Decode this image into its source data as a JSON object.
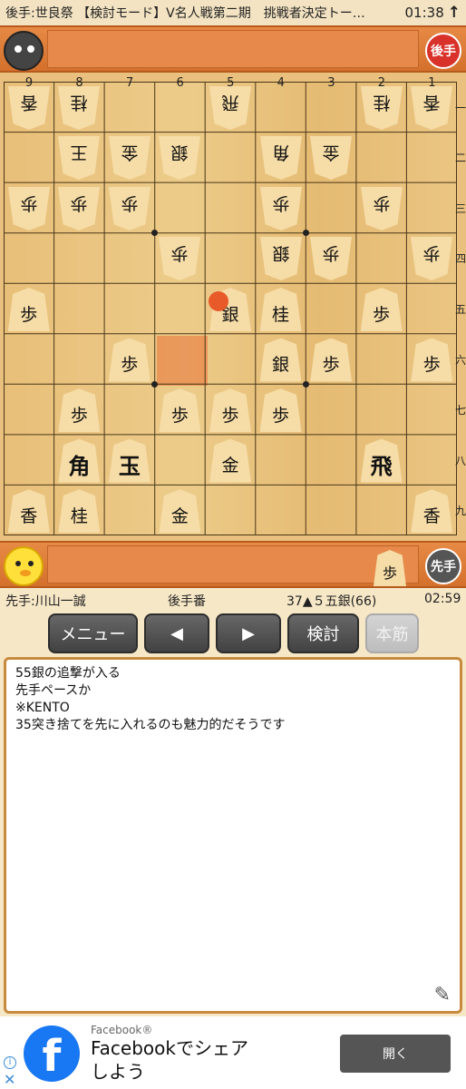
{
  "top_bar": {
    "title": "後手:世良祭 【検討モード】V名人戦第二期　挑戦者決定トー…",
    "clock": "01:38",
    "arrow": "↑"
  },
  "gote": {
    "badge": "後手"
  },
  "sente": {
    "badge": "先手",
    "hand_piece": "歩"
  },
  "board": {
    "col_numbers": [
      "9",
      "8",
      "7",
      "6",
      "5",
      "4",
      "3",
      "2",
      "1"
    ],
    "row_numbers": [
      "一",
      "二",
      "三",
      "四",
      "五",
      "六",
      "七",
      "八",
      "九"
    ],
    "pieces": [
      {
        "file": 9,
        "rank": 1,
        "label": "香",
        "owner": "gote"
      },
      {
        "file": 8,
        "rank": 1,
        "label": "桂",
        "owner": "gote"
      },
      {
        "file": 5,
        "rank": 1,
        "label": "飛",
        "owner": "gote"
      },
      {
        "file": 2,
        "rank": 1,
        "label": "桂",
        "owner": "gote"
      },
      {
        "file": 1,
        "rank": 1,
        "label": "香",
        "owner": "gote"
      },
      {
        "file": 8,
        "rank": 2,
        "label": "王",
        "owner": "gote"
      },
      {
        "file": 7,
        "rank": 2,
        "label": "金",
        "owner": "gote"
      },
      {
        "file": 6,
        "rank": 2,
        "label": "銀",
        "owner": "gote"
      },
      {
        "file": 4,
        "rank": 2,
        "label": "角",
        "owner": "gote"
      },
      {
        "file": 3,
        "rank": 2,
        "label": "金",
        "owner": "gote"
      },
      {
        "file": 9,
        "rank": 3,
        "label": "歩",
        "owner": "gote"
      },
      {
        "file": 8,
        "rank": 3,
        "label": "歩",
        "owner": "gote"
      },
      {
        "file": 7,
        "rank": 3,
        "label": "歩",
        "owner": "gote"
      },
      {
        "file": 4,
        "rank": 3,
        "label": "歩",
        "owner": "gote"
      },
      {
        "file": 2,
        "rank": 3,
        "label": "歩",
        "owner": "gote"
      },
      {
        "file": 6,
        "rank": 4,
        "label": "歩",
        "owner": "gote"
      },
      {
        "file": 4,
        "rank": 4,
        "label": "銀",
        "owner": "gote"
      },
      {
        "file": 3,
        "rank": 4,
        "label": "歩",
        "owner": "gote"
      },
      {
        "file": 1,
        "rank": 4,
        "label": "歩",
        "owner": "gote"
      },
      {
        "file": 9,
        "rank": 5,
        "label": "歩",
        "owner": "sente"
      },
      {
        "file": 5,
        "rank": 5,
        "label": "銀",
        "owner": "sente"
      },
      {
        "file": 4,
        "rank": 5,
        "label": "桂",
        "owner": "sente"
      },
      {
        "file": 2,
        "rank": 5,
        "label": "歩",
        "owner": "sente"
      },
      {
        "file": 7,
        "rank": 6,
        "label": "歩",
        "owner": "sente"
      },
      {
        "file": 4,
        "rank": 6,
        "label": "銀",
        "owner": "sente"
      },
      {
        "file": 3,
        "rank": 6,
        "label": "歩",
        "owner": "sente"
      },
      {
        "file": 1,
        "rank": 6,
        "label": "歩",
        "owner": "sente"
      },
      {
        "file": 8,
        "rank": 7,
        "label": "歩",
        "owner": "sente"
      },
      {
        "file": 6,
        "rank": 7,
        "label": "歩",
        "owner": "sente"
      },
      {
        "file": 5,
        "rank": 7,
        "label": "歩",
        "owner": "sente"
      },
      {
        "file": 4,
        "rank": 7,
        "label": "歩",
        "owner": "sente"
      },
      {
        "file": 8,
        "rank": 8,
        "label": "角",
        "owner": "sente",
        "big": true
      },
      {
        "file": 7,
        "rank": 8,
        "label": "玉",
        "owner": "sente",
        "big": true
      },
      {
        "file": 5,
        "rank": 8,
        "label": "金",
        "owner": "sente"
      },
      {
        "file": 2,
        "rank": 8,
        "label": "飛",
        "owner": "sente",
        "big": true
      },
      {
        "file": 9,
        "rank": 9,
        "label": "香",
        "owner": "sente"
      },
      {
        "file": 8,
        "rank": 9,
        "label": "桂",
        "owner": "sente"
      },
      {
        "file": 6,
        "rank": 9,
        "label": "金",
        "owner": "sente"
      },
      {
        "file": 1,
        "rank": 9,
        "label": "香",
        "owner": "sente"
      }
    ],
    "highlight_square": {
      "file": 6,
      "rank": 6
    }
  },
  "info_bar": {
    "sente_name": "先手:川山一誠",
    "turn": "後手番",
    "move": "37▲５五銀(66)",
    "clock": "02:59"
  },
  "buttons": {
    "menu": "メニュー",
    "prev": "◀",
    "next": "▶",
    "analyze": "検討",
    "mainline": "本筋"
  },
  "comment": {
    "lines": [
      "55銀の追撃が入る",
      "先手ペースか",
      "※KENTO",
      "35突き捨てを先に入れるのも魅力的だそうです"
    ],
    "pen_icon": "✎"
  },
  "ad": {
    "source": "Facebook®",
    "title_line1": "Facebookでシェア",
    "title_line2": "しよう",
    "open_button": "開く",
    "fb_letter": "f",
    "info_icon": "i",
    "close_icon": "✕"
  }
}
